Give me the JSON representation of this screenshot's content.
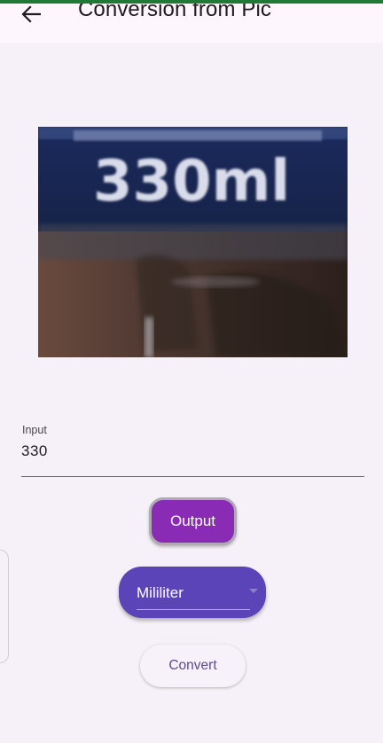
{
  "app_bar": {
    "title": "Conversion from Pic",
    "back_icon": "arrow-left-icon"
  },
  "photo": {
    "text_in_photo": "330ml"
  },
  "input": {
    "label": "Input",
    "value": "330"
  },
  "output_button": {
    "label": "Output",
    "color": "#8a2bb5"
  },
  "unit_select": {
    "selected": "Mililiter",
    "caret_icon": "dropdown-arrow-icon",
    "color": "#5b44b8"
  },
  "convert_button": {
    "label": "Convert"
  }
}
